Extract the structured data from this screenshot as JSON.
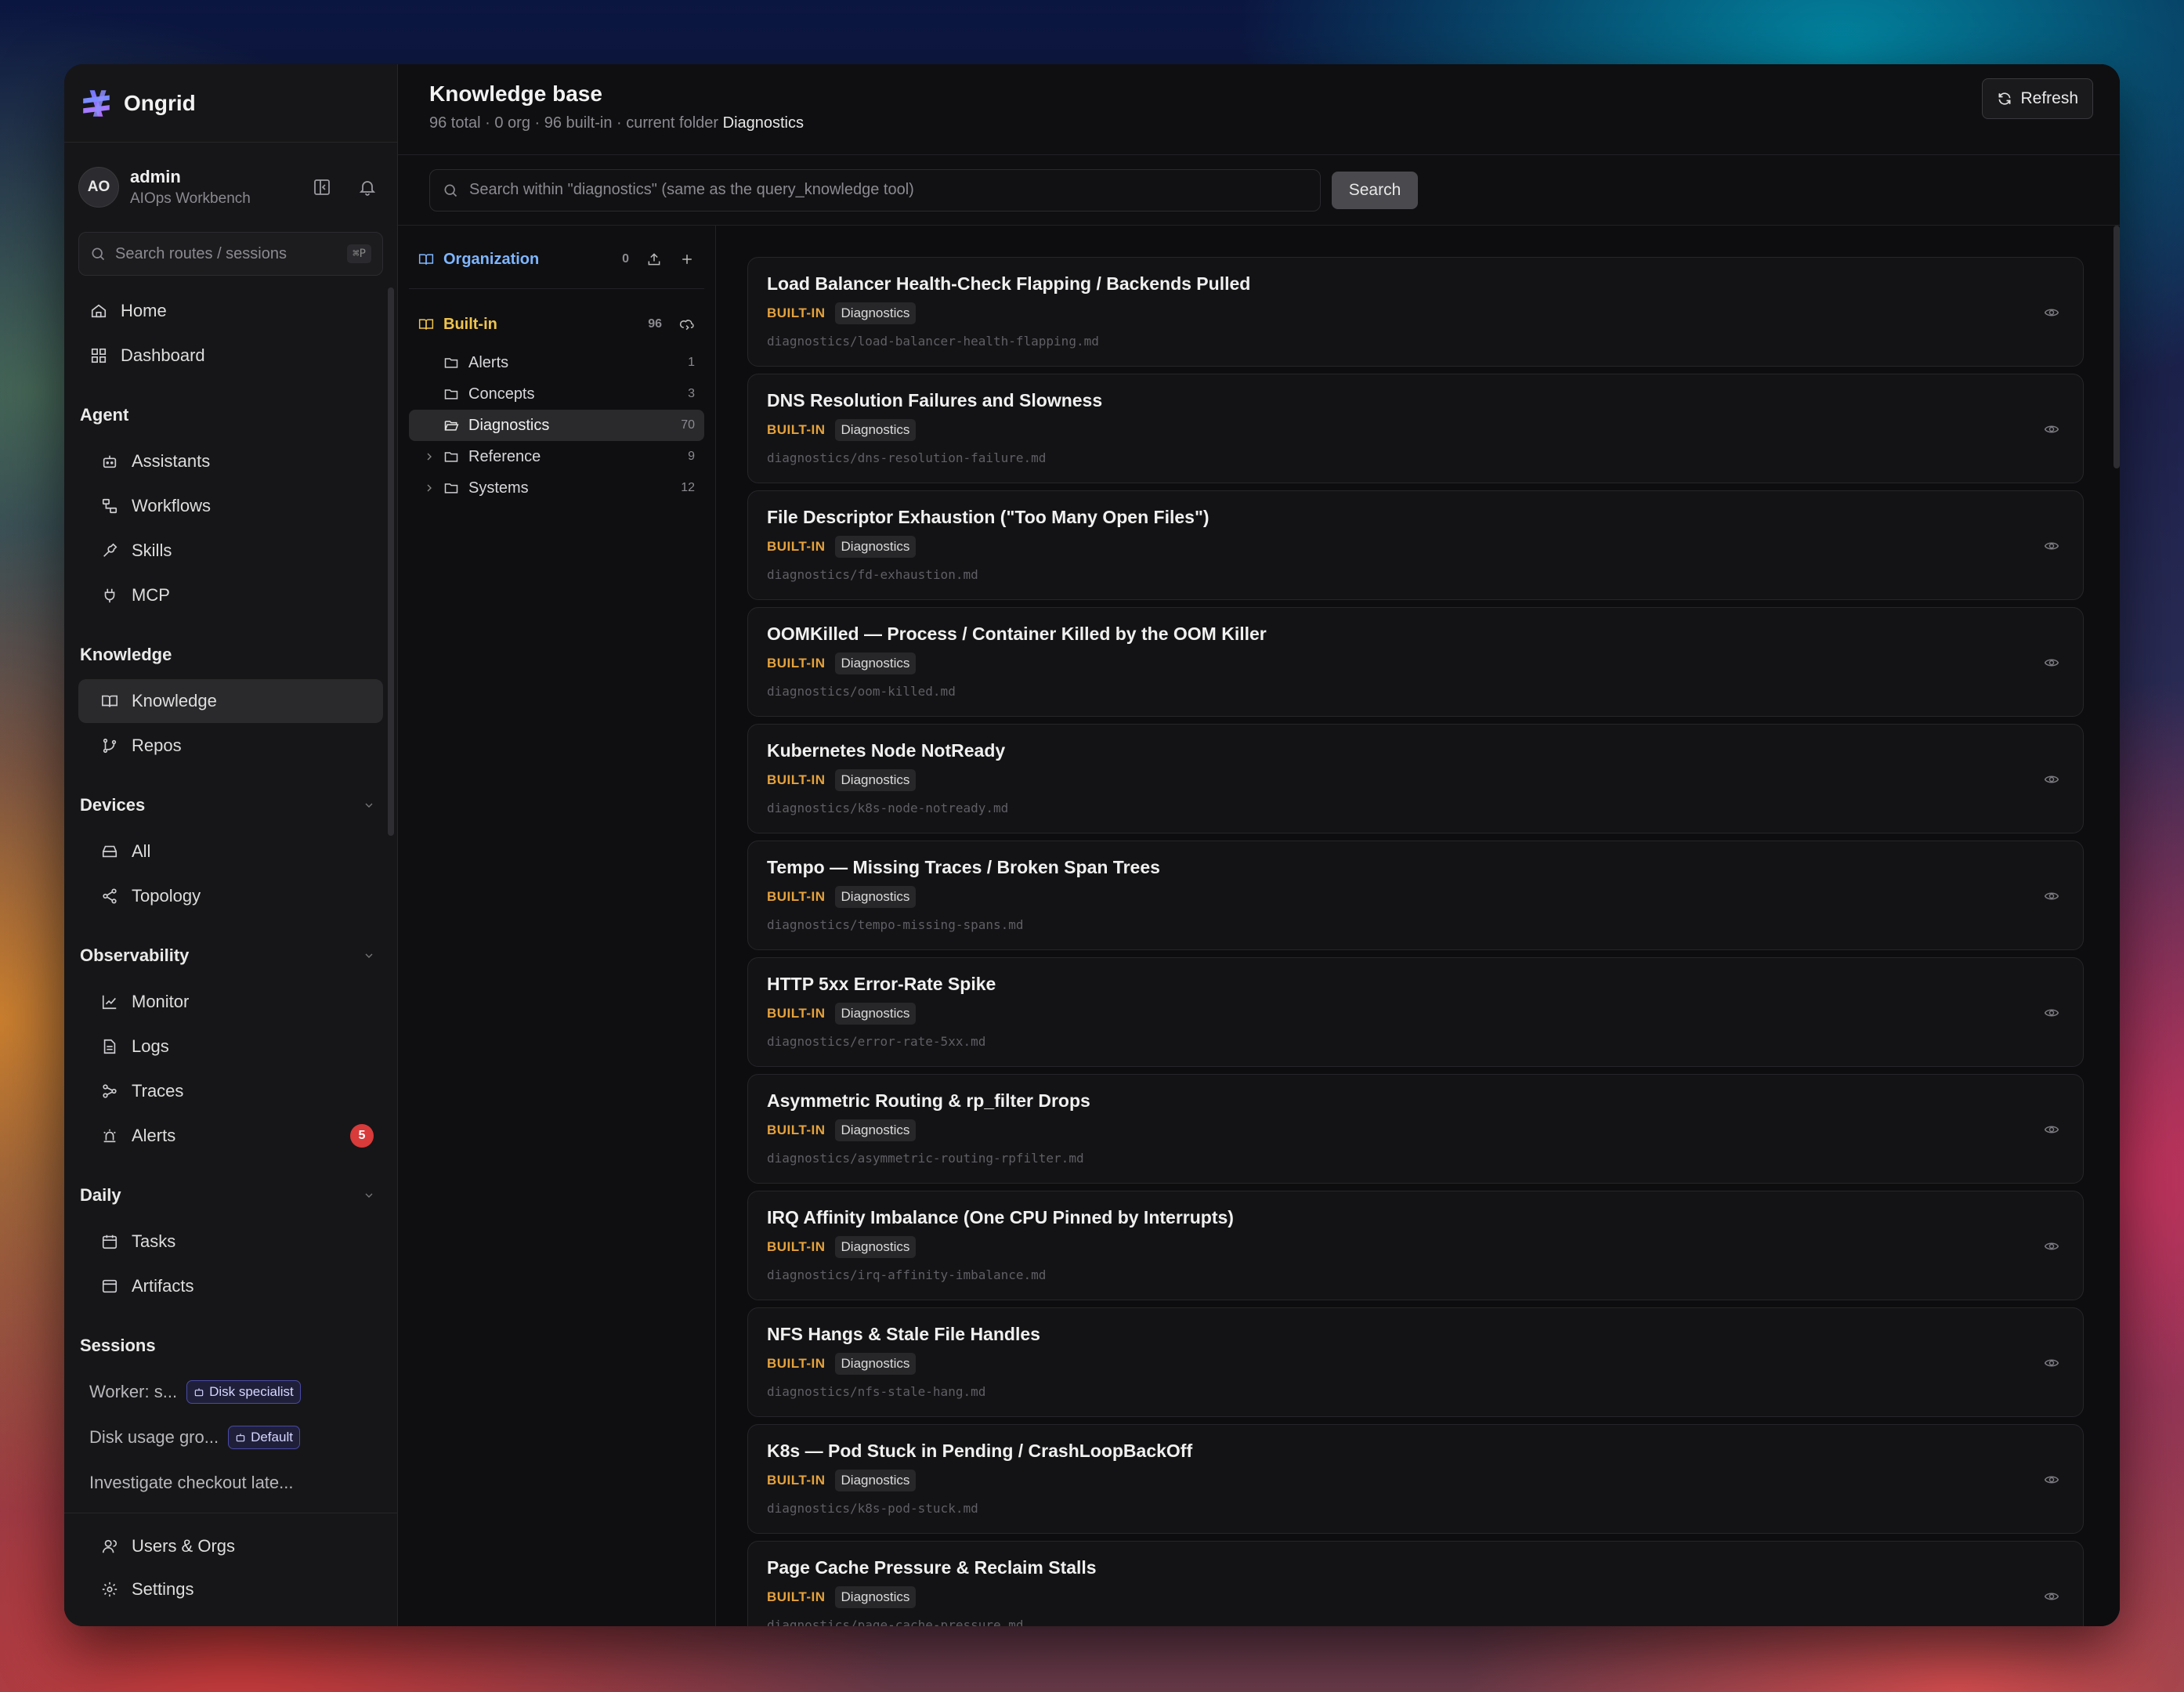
{
  "app": {
    "name": "Ongrid"
  },
  "user": {
    "initials": "AO",
    "name": "admin",
    "subtitle": "AIOps Workbench"
  },
  "sidebar_search": {
    "placeholder": "Search routes / sessions",
    "shortcut": "⌘P"
  },
  "nav_top": [
    {
      "label": "Home",
      "icon": "home-icon"
    },
    {
      "label": "Dashboard",
      "icon": "dashboard-icon"
    }
  ],
  "sections": {
    "agent": {
      "title": "Agent",
      "items": [
        "Assistants",
        "Workflows",
        "Skills",
        "MCP"
      ]
    },
    "knowledge": {
      "title": "Knowledge",
      "items": [
        "Knowledge",
        "Repos"
      ]
    },
    "devices": {
      "title": "Devices",
      "items": [
        "All",
        "Topology"
      ]
    },
    "observability": {
      "title": "Observability",
      "items": [
        "Monitor",
        "Logs",
        "Traces",
        "Alerts"
      ],
      "alerts_count": "5"
    },
    "daily": {
      "title": "Daily",
      "items": [
        "Tasks",
        "Artifacts"
      ]
    },
    "sessions": {
      "title": "Sessions",
      "items": [
        {
          "label": "Worker: s...",
          "badge": "Disk specialist"
        },
        {
          "label": "Disk usage gro...",
          "badge": "Default"
        },
        {
          "label": "Investigate checkout late...",
          "badge": ""
        }
      ]
    }
  },
  "bottom_nav": [
    "Users & Orgs",
    "Settings"
  ],
  "header": {
    "title": "Knowledge base",
    "stats": "96 total · 0 org · 96 built-in · current folder",
    "current_folder": "Diagnostics",
    "refresh_label": "Refresh"
  },
  "kb_search": {
    "placeholder": "Search within \"diagnostics\" (same as the query_knowledge tool)",
    "button": "Search"
  },
  "tree": {
    "organization": {
      "label": "Organization",
      "count": "0"
    },
    "builtin": {
      "label": "Built-in",
      "count": "96"
    },
    "folders": [
      {
        "label": "Alerts",
        "count": "1",
        "expandable": false
      },
      {
        "label": "Concepts",
        "count": "3",
        "expandable": false
      },
      {
        "label": "Diagnostics",
        "count": "70",
        "expandable": false,
        "active": true
      },
      {
        "label": "Reference",
        "count": "9",
        "expandable": true
      },
      {
        "label": "Systems",
        "count": "12",
        "expandable": true
      }
    ]
  },
  "colors": {
    "builtin_tag": "#e6a23c",
    "org_accent": "#7fb6ff",
    "alert_badge": "#d93a3a"
  },
  "documents": [
    {
      "title": "Load Balancer Health-Check Flapping / Backends Pulled",
      "source": "BUILT-IN",
      "category": "Diagnostics",
      "path": "diagnostics/load-balancer-health-flapping.md"
    },
    {
      "title": "DNS Resolution Failures and Slowness",
      "source": "BUILT-IN",
      "category": "Diagnostics",
      "path": "diagnostics/dns-resolution-failure.md"
    },
    {
      "title": "File Descriptor Exhaustion (\"Too Many Open Files\")",
      "source": "BUILT-IN",
      "category": "Diagnostics",
      "path": "diagnostics/fd-exhaustion.md"
    },
    {
      "title": "OOMKilled — Process / Container Killed by the OOM Killer",
      "source": "BUILT-IN",
      "category": "Diagnostics",
      "path": "diagnostics/oom-killed.md"
    },
    {
      "title": "Kubernetes Node NotReady",
      "source": "BUILT-IN",
      "category": "Diagnostics",
      "path": "diagnostics/k8s-node-notready.md"
    },
    {
      "title": "Tempo — Missing Traces / Broken Span Trees",
      "source": "BUILT-IN",
      "category": "Diagnostics",
      "path": "diagnostics/tempo-missing-spans.md"
    },
    {
      "title": "HTTP 5xx Error-Rate Spike",
      "source": "BUILT-IN",
      "category": "Diagnostics",
      "path": "diagnostics/error-rate-5xx.md"
    },
    {
      "title": "Asymmetric Routing & rp_filter Drops",
      "source": "BUILT-IN",
      "category": "Diagnostics",
      "path": "diagnostics/asymmetric-routing-rpfilter.md"
    },
    {
      "title": "IRQ Affinity Imbalance (One CPU Pinned by Interrupts)",
      "source": "BUILT-IN",
      "category": "Diagnostics",
      "path": "diagnostics/irq-affinity-imbalance.md"
    },
    {
      "title": "NFS Hangs & Stale File Handles",
      "source": "BUILT-IN",
      "category": "Diagnostics",
      "path": "diagnostics/nfs-stale-hang.md"
    },
    {
      "title": "K8s — Pod Stuck in Pending / CrashLoopBackOff",
      "source": "BUILT-IN",
      "category": "Diagnostics",
      "path": "diagnostics/k8s-pod-stuck.md"
    },
    {
      "title": "Page Cache Pressure & Reclaim Stalls",
      "source": "BUILT-IN",
      "category": "Diagnostics",
      "path": "diagnostics/page-cache-pressure.md"
    }
  ]
}
